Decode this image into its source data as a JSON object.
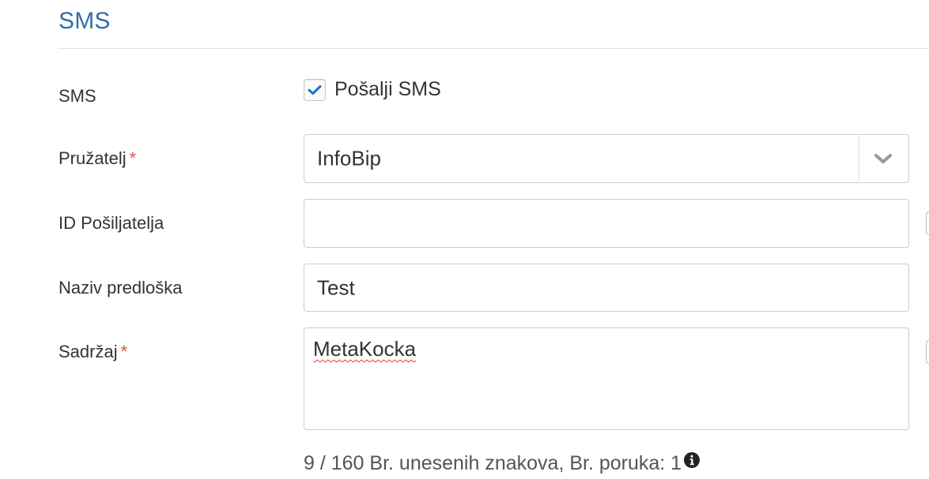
{
  "section": {
    "title": "SMS"
  },
  "fields": {
    "sms": {
      "label": "SMS",
      "checkbox_label": "Pošalji SMS",
      "checked": true
    },
    "provider": {
      "label": "Pružatelj",
      "required_mark": "*",
      "value": "InfoBip"
    },
    "sender_id": {
      "label": "ID Pošiljatelja",
      "value": ""
    },
    "template_name": {
      "label": "Naziv predloška",
      "value": "Test"
    },
    "content": {
      "label": "Sadržaj",
      "required_mark": "*",
      "value": "MetaKocka"
    }
  },
  "counter": {
    "text": "9 / 160 Br. unesenih znakova, Br. poruka: 1"
  },
  "colors": {
    "accent": "#2f6ea8",
    "required": "#d9534f",
    "check": "#1a73c9"
  },
  "icons": {
    "checkbox": "check-icon",
    "select": "chevron-down-icon",
    "info": "info-icon"
  }
}
